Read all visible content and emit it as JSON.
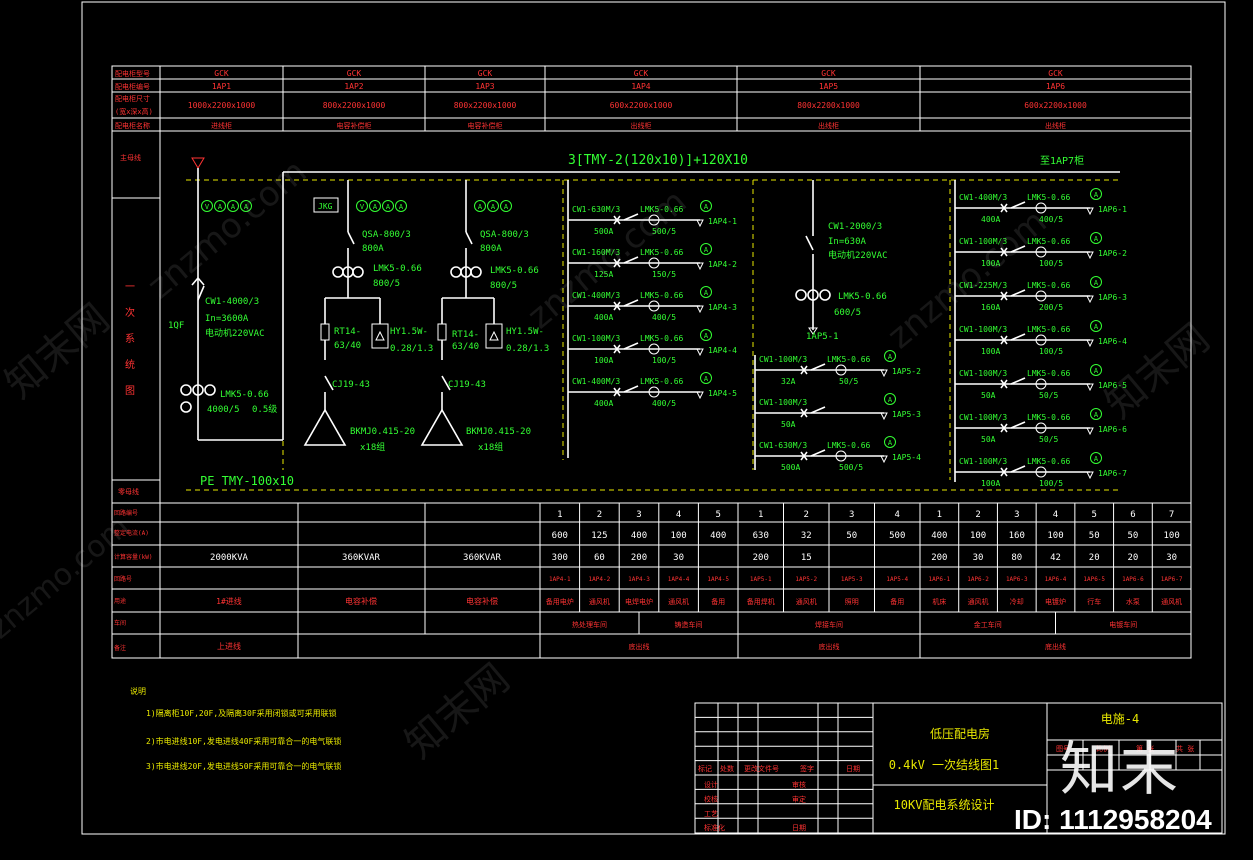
{
  "header_rows": {
    "labels": [
      "配电柜型号",
      "配电柜编号",
      "配电柜尺寸",
      "(宽x深x高)",
      "配电柜名称"
    ],
    "panels": [
      {
        "model": "GCK",
        "id": "1AP1",
        "size": "1000x2200x1000",
        "name": "进线柜"
      },
      {
        "model": "GCK",
        "id": "1AP2",
        "size": "800x2200x1000",
        "name": "电容补偿柜"
      },
      {
        "model": "GCK",
        "id": "1AP3",
        "size": "800x2200x1000",
        "name": "电容补偿柜"
      },
      {
        "model": "GCK",
        "id": "1AP4",
        "size": "600x2200x1000",
        "name": "出线柜"
      },
      {
        "model": "GCK",
        "id": "1AP5",
        "size": "800x2200x1000",
        "name": "出线柜"
      },
      {
        "model": "GCK",
        "id": "1AP6",
        "size": "600x2200x1000",
        "name": "出线柜"
      }
    ]
  },
  "left_labels": {
    "busbar": "主母线",
    "primary": [
      "一",
      "次",
      "系",
      "统",
      "图"
    ],
    "pe_bus": "零母线"
  },
  "busbar": {
    "main": "3[TMY-2(120x10)]+120X10",
    "to_next": "至1AP7柜",
    "pe": "PE  TMY-100x10"
  },
  "panel1": {
    "meters": [
      "V",
      "A",
      "A",
      "A"
    ],
    "breaker": [
      "CW1-4000/3",
      "In=3600A",
      "电动机220VAC"
    ],
    "breaker_id": "1QF",
    "ct": [
      "LMK5-0.66",
      "4000/5",
      "0.5级"
    ]
  },
  "panel2": {
    "ctrl": "JKG",
    "meters": [
      "V",
      "A",
      "A",
      "A"
    ],
    "switch": [
      "QSA-800/3",
      "800A"
    ],
    "ct": [
      "LMK5-0.66",
      "800/5"
    ],
    "fuse": [
      "RT14-",
      "63/40"
    ],
    "reactor": [
      "HY1.5W-",
      "0.28/1.3"
    ],
    "contactor": "CJ19-43",
    "cap": [
      "BKMJ0.415-20",
      "x18组"
    ]
  },
  "panel3": {
    "meters": [
      "A",
      "A",
      "A"
    ],
    "switch": [
      "QSA-800/3",
      "800A"
    ],
    "ct": [
      "LMK5-0.66",
      "800/5"
    ],
    "fuse": [
      "RT14-",
      "63/40"
    ],
    "reactor": [
      "HY1.5W-",
      "0.28/1.3"
    ],
    "contactor": "CJ19-43",
    "cap": [
      "BKMJ0.415-20",
      "x18组"
    ]
  },
  "panel4": {
    "circuits": [
      {
        "br": "CW1-630M/3",
        "rate": "500A",
        "ct": "LMK5-0.66",
        "ratio": "500/5",
        "out": "1AP4-1"
      },
      {
        "br": "CW1-160M/3",
        "rate": "125A",
        "ct": "LMK5-0.66",
        "ratio": "150/5",
        "out": "1AP4-2"
      },
      {
        "br": "CW1-400M/3",
        "rate": "400A",
        "ct": "LMK5-0.66",
        "ratio": "400/5",
        "out": "1AP4-3"
      },
      {
        "br": "CW1-100M/3",
        "rate": "100A",
        "ct": "LMK5-0.66",
        "ratio": "100/5",
        "out": "1AP4-4"
      },
      {
        "br": "CW1-400M/3",
        "rate": "400A",
        "ct": "LMK5-0.66",
        "ratio": "400/5",
        "out": "1AP4-5"
      }
    ]
  },
  "panel5": {
    "main": {
      "br": [
        "CW1-2000/3",
        "In=630A",
        "电动机220VAC"
      ],
      "ct": [
        "LMK5-0.66",
        "600/5"
      ],
      "out": "1AP5-1"
    },
    "circuits": [
      {
        "br": "CW1-100M/3",
        "rate": "32A",
        "ct": "LMK5-0.66",
        "ratio": "50/5",
        "out": "1AP5-2"
      },
      {
        "br": "CW1-100M/3",
        "rate": "50A",
        "ct": "",
        "ratio": "",
        "out": "1AP5-3"
      },
      {
        "br": "CW1-630M/3",
        "rate": "500A",
        "ct": "LMK5-0.66",
        "ratio": "500/5",
        "out": "1AP5-4"
      }
    ]
  },
  "panel6": {
    "circuits": [
      {
        "br": "CW1-400M/3",
        "rate": "400A",
        "ct": "LMK5-0.66",
        "ratio": "400/5",
        "out": "1AP6-1"
      },
      {
        "br": "CW1-100M/3",
        "rate": "100A",
        "ct": "LMK5-0.66",
        "ratio": "100/5",
        "out": "1AP6-2"
      },
      {
        "br": "CW1-225M/3",
        "rate": "160A",
        "ct": "LMK5-0.66",
        "ratio": "200/5",
        "out": "1AP6-3"
      },
      {
        "br": "CW1-100M/3",
        "rate": "100A",
        "ct": "LMK5-0.66",
        "ratio": "100/5",
        "out": "1AP6-4"
      },
      {
        "br": "CW1-100M/3",
        "rate": "50A",
        "ct": "LMK5-0.66",
        "ratio": "50/5",
        "out": "1AP6-5"
      },
      {
        "br": "CW1-100M/3",
        "rate": "50A",
        "ct": "LMK5-0.66",
        "ratio": "50/5",
        "out": "1AP6-6"
      },
      {
        "br": "CW1-100M/3",
        "rate": "100A",
        "ct": "LMK5-0.66",
        "ratio": "100/5",
        "out": "1AP6-7"
      }
    ]
  },
  "bottom_table": {
    "row_labels": [
      "回路编号",
      "整定电流(A)",
      "计算容量(kW)",
      "回路号",
      "用途",
      "车间",
      "备注"
    ],
    "cap_1": "2000KVA",
    "cap_2": "360KVAR",
    "cap_3": "360KVAR",
    "use_1": "1#进线",
    "use_2": "电容补偿",
    "use_3": "电容补偿",
    "remark_1": "上进线",
    "p4": {
      "nums": [
        "1",
        "2",
        "3",
        "4",
        "5"
      ],
      "set": [
        "600",
        "125",
        "400",
        "100",
        "400"
      ],
      "kw": [
        "300",
        "60",
        "200",
        "30",
        ""
      ],
      "ids": [
        "1AP4-1",
        "1AP4-2",
        "1AP4-3",
        "1AP4-4",
        "1AP4-5"
      ],
      "uses": [
        "备用电炉",
        "通风机",
        "电焊电炉",
        "通风机",
        "备用"
      ],
      "shop": [
        "热处理车间",
        "铸造车间"
      ],
      "remark": "底出线"
    },
    "p5": {
      "nums": [
        "1",
        "2",
        "3",
        "4"
      ],
      "set": [
        "630",
        "32",
        "50",
        "500"
      ],
      "kw": [
        "200",
        "15",
        "",
        ""
      ],
      "ids": [
        "1AP5-1",
        "1AP5-2",
        "1AP5-3",
        "1AP5-4"
      ],
      "uses": [
        "备用焊机",
        "通风机",
        "照明",
        "备用"
      ],
      "shop": "焊接车间",
      "remark": "底出线"
    },
    "p6": {
      "nums": [
        "1",
        "2",
        "3",
        "4",
        "5",
        "6",
        "7"
      ],
      "set": [
        "400",
        "100",
        "160",
        "100",
        "50",
        "50",
        "100"
      ],
      "kw": [
        "200",
        "30",
        "80",
        "42",
        "20",
        "20",
        "30"
      ],
      "ids": [
        "1AP6-1",
        "1AP6-2",
        "1AP6-3",
        "1AP6-4",
        "1AP6-5",
        "1AP6-6",
        "1AP6-7"
      ],
      "uses": [
        "机床",
        "通风机",
        "冷却",
        "电镀炉",
        "行车",
        "水泵",
        "通风机"
      ],
      "shop": [
        "金工车间",
        "电镀车间"
      ],
      "remark": "底出线"
    }
  },
  "notes": {
    "title": "说明",
    "lines": [
      "1)隔离柜10F,20F,及隔离30F采用闭锁或可采用联锁",
      "2)市电进线10F,发电进线40F采用可靠合一的电气联锁",
      "3)市电进线20F,发电进线50F采用可靠合一的电气联锁"
    ]
  },
  "title_block": {
    "project": "低压配电房",
    "drawing": "0.4kV  一次结线图1",
    "subtitle": "10KV配电系统设计",
    "number": "电施-4",
    "rows": [
      "标记",
      "处数",
      "更改文件号",
      "签字",
      "日期"
    ],
    "roles": [
      "设计",
      "校核",
      "工艺",
      "标准化"
    ],
    "roles2": [
      "审核",
      "审定",
      "",
      "日期"
    ],
    "side": [
      "图号",
      "比例",
      "第 张",
      "共 张"
    ]
  },
  "watermark": {
    "site": "znzmo.com",
    "brand": "知末网",
    "logo": "知末",
    "id": "ID: 1112958204"
  }
}
